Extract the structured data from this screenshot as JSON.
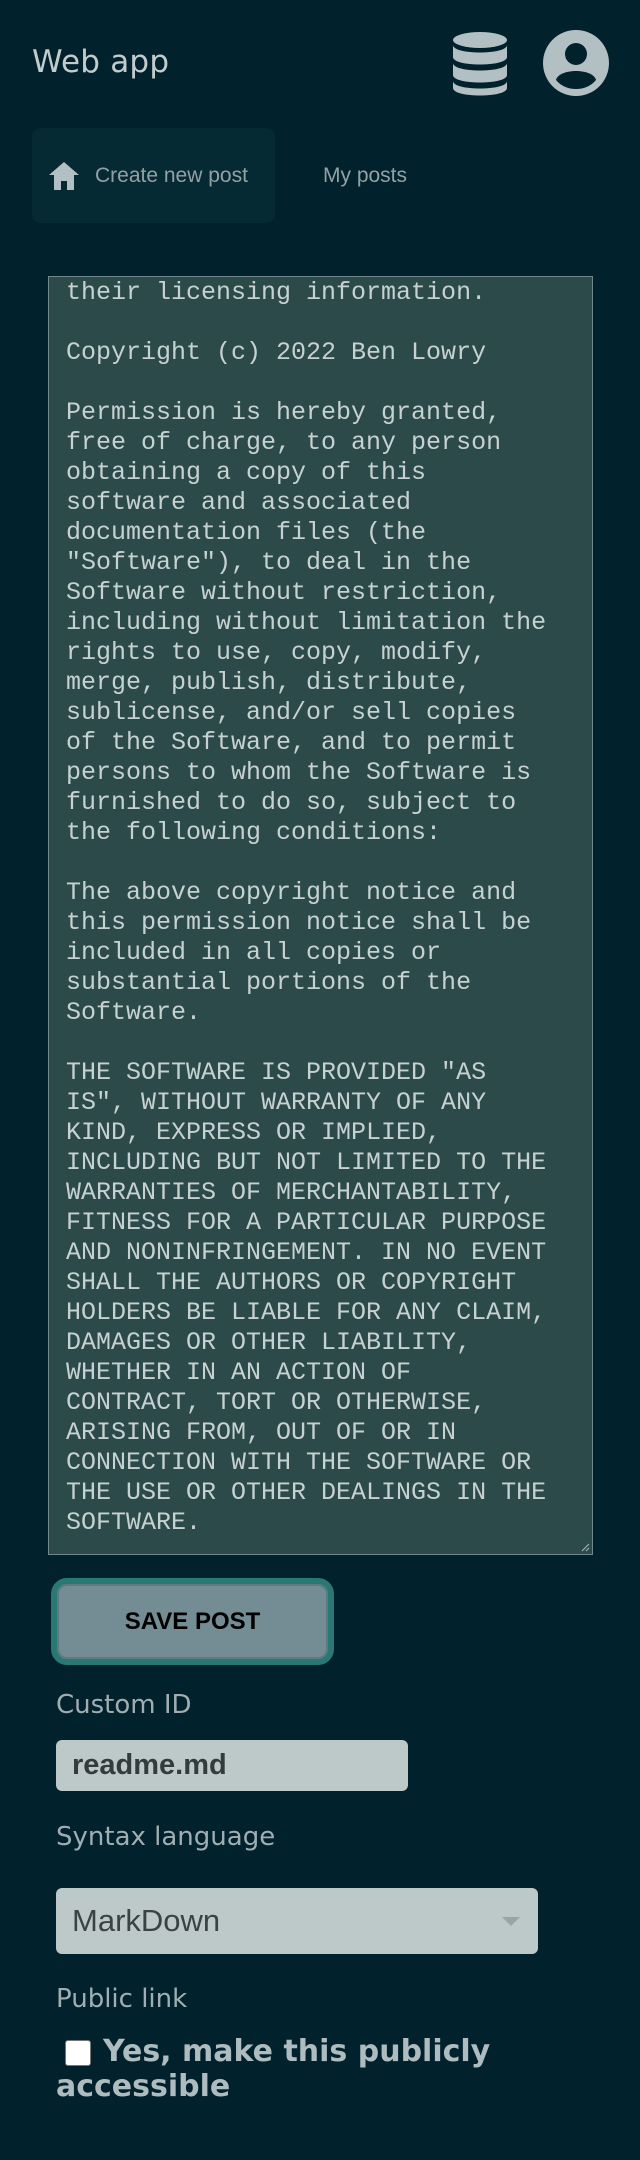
{
  "header": {
    "app_title": "Web app",
    "icons": [
      "database-icon",
      "user-account-icon"
    ]
  },
  "nav": {
    "tabs": [
      {
        "label": "Create new post",
        "icon": "home-icon",
        "active": true
      },
      {
        "label": "My posts",
        "active": false
      }
    ]
  },
  "editor": {
    "content": "their licensing information.\n\nCopyright (c) 2022 Ben Lowry\n\nPermission is hereby granted,\nfree of charge, to any person\nobtaining a copy of this\nsoftware and associated\ndocumentation files (the\n\"Software\"), to deal in the\nSoftware without restriction,\nincluding without limitation the\nrights to use, copy, modify,\nmerge, publish, distribute,\nsublicense, and/or sell copies\nof the Software, and to permit\npersons to whom the Software is\nfurnished to do so, subject to\nthe following conditions:\n\nThe above copyright notice and\nthis permission notice shall be\nincluded in all copies or\nsubstantial portions of the\nSoftware.\n\nTHE SOFTWARE IS PROVIDED \"AS\nIS\", WITHOUT WARRANTY OF ANY\nKIND, EXPRESS OR IMPLIED,\nINCLUDING BUT NOT LIMITED TO THE\nWARRANTIES OF MERCHANTABILITY,\nFITNESS FOR A PARTICULAR PURPOSE\nAND NONINFRINGEMENT. IN NO EVENT\nSHALL THE AUTHORS OR COPYRIGHT\nHOLDERS BE LIABLE FOR ANY CLAIM,\nDAMAGES OR OTHER LIABILITY,\nWHETHER IN AN ACTION OF\nCONTRACT, TORT OR OTHERWISE,\nARISING FROM, OUT OF OR IN\nCONNECTION WITH THE SOFTWARE OR\nTHE USE OR OTHER DEALINGS IN THE\nSOFTWARE."
  },
  "form": {
    "save_label": "SAVE POST",
    "custom_id": {
      "label": "Custom ID",
      "value": "readme.md"
    },
    "syntax": {
      "label": "Syntax language",
      "selected": "MarkDown"
    },
    "public_link": {
      "label": "Public link",
      "checkbox_label": "Yes, make this publicly accessible",
      "checked": false
    }
  },
  "colors": {
    "background": "#01212d",
    "editor_bg": "#2c4a49",
    "button_bg": "#748c94",
    "button_border": "#2a7873",
    "input_bg": "#bdc8c9"
  }
}
